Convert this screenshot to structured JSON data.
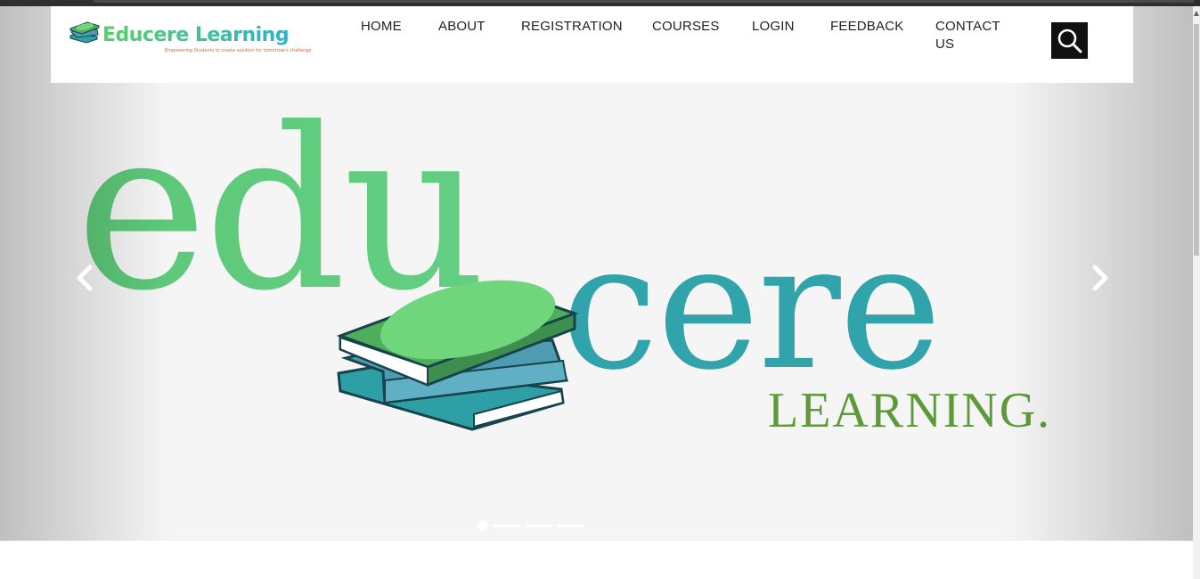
{
  "logo": {
    "brand": "Educere Learning",
    "tagline": "Empowering Students to create solution for tomorrow's challenge."
  },
  "nav": {
    "items": [
      {
        "label": "HOME"
      },
      {
        "label": "ABOUT"
      },
      {
        "label": "REGISTRATION"
      },
      {
        "label": "COURSES"
      },
      {
        "label": "LOGIN"
      },
      {
        "label": "FEEDBACK"
      },
      {
        "label": "CONTACT US"
      }
    ],
    "search_icon": "search-icon"
  },
  "slider": {
    "slide_text": {
      "edu": "edu",
      "cere": "cere",
      "learning": "LEARNING."
    },
    "prev_icon": "chevron-left-icon",
    "next_icon": "chevron-right-icon",
    "indicator_count": 4,
    "active_indicator": 1
  },
  "colors": {
    "green": "#5fcf78",
    "teal": "#30a3ab",
    "olive": "#5e9a3a",
    "dark_book_edge": "#1f4f5a"
  }
}
